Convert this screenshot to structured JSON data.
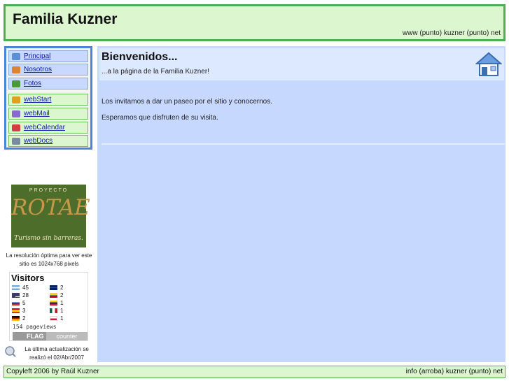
{
  "header": {
    "title": "Familia Kuzner",
    "url_text": "www (punto) kuzner (punto) net"
  },
  "nav": {
    "items": [
      {
        "label": "Principal",
        "icon": "home-icon",
        "color": "#5b8fd6"
      },
      {
        "label": "Nosotros",
        "icon": "people-icon",
        "color": "#d9862e"
      },
      {
        "label": "Fotos",
        "icon": "photo-icon",
        "color": "#4a9a3a"
      },
      {
        "label": "webStart",
        "icon": "brush-icon",
        "color": "#e0a020"
      },
      {
        "label": "webMail",
        "icon": "mail-icon",
        "color": "#8a6ad0"
      },
      {
        "label": "webCalendar",
        "icon": "calendar-icon",
        "color": "#d04040"
      },
      {
        "label": "webDocs",
        "icon": "document-icon",
        "color": "#7a8aa0"
      }
    ]
  },
  "content": {
    "title": "Bienvenidos...",
    "subtitle": "...a la página de la Familia Kuzner!",
    "paragraphs": [
      "Los invitamos a dar un paseo por el sitio y conocernos.",
      "Esperamos que disfruten de su visita."
    ]
  },
  "promo": {
    "top_text": "PROYECTO",
    "brand": "ROTAE",
    "tagline": "Turismo sin barreras."
  },
  "resolution_note": "La resolución óptima para ver este sitio es 1024x768 pixels",
  "visitors": {
    "title": "Visitors",
    "countries": [
      {
        "count": "45",
        "flag": "argentina-flag",
        "colors": [
          "#74acdf",
          "#ffffff",
          "#74acdf"
        ]
      },
      {
        "count": "28",
        "flag": "usa-flag",
        "colors": [
          "#b22234",
          "#ffffff",
          "#3c3b6e"
        ]
      },
      {
        "count": "5",
        "flag": "russia-flag",
        "colors": [
          "#ffffff",
          "#0039a6",
          "#d52b1e"
        ]
      },
      {
        "count": "3",
        "flag": "spain-flag",
        "colors": [
          "#c60b1e",
          "#ffc400",
          "#c60b1e"
        ]
      },
      {
        "count": "2",
        "flag": "germany-flag",
        "colors": [
          "#000000",
          "#dd0000",
          "#ffce00"
        ]
      },
      {
        "count": "2",
        "flag": "uk-flag",
        "colors": [
          "#012169",
          "#c8102e",
          "#012169"
        ]
      },
      {
        "count": "2",
        "flag": "colombia-flag",
        "colors": [
          "#fcd116",
          "#003893",
          "#ce1126"
        ]
      },
      {
        "count": "1",
        "flag": "venezuela-flag",
        "colors": [
          "#ffcc00",
          "#00247d",
          "#cf142b"
        ]
      },
      {
        "count": "1",
        "flag": "mexico-flag",
        "colors": [
          "#006847",
          "#ffffff",
          "#ce1126"
        ]
      },
      {
        "count": "1",
        "flag": "poland-flag",
        "colors": [
          "#ffffff",
          "#dc143c",
          "#dc143c"
        ]
      }
    ],
    "pageviews": "154 pageviews",
    "counter_flag": "FLAG",
    "counter_name": "counter"
  },
  "update_note": "La última actualización se realizó el 02/Abr/2007",
  "footer": {
    "left": "Copyleft 2006 by Raúl Kuzner",
    "right": "info (arroba) kuzner (punto) net"
  }
}
